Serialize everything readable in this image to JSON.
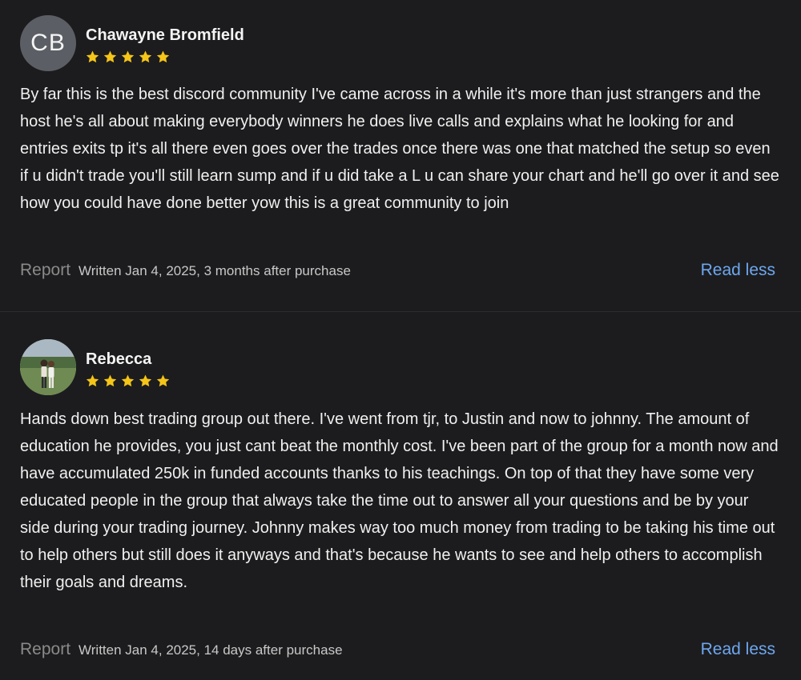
{
  "reviews": [
    {
      "avatar_initials": "CB",
      "name": "Chawayne Bromfield",
      "rating": 5,
      "text": "By far this is the best discord community I've came across in a while it's more than just strangers and the host he's all about making everybody winners he does live calls and explains what he looking for and entries exits tp it's all there even goes over the trades once there was one that matched the setup so even if u didn't trade you'll still learn sump and if u did take a L u can share your chart and he'll go over it and see how you could have done better yow this is a great community to join",
      "report_label": "Report",
      "written": "Written Jan 4, 2025, 3 months after purchase",
      "toggle_label": "Read less"
    },
    {
      "name": "Rebecca",
      "rating": 5,
      "text": "Hands down best trading group out there. I've went from tjr, to Justin and now to johnny. The amount of education he provides, you just cant beat the monthly cost. I've been part of the group for a month now and have accumulated 250k in funded accounts thanks to his teachings. On top of that they have some very educated people in the group that always take the time out to answer all your questions and be by your side during your trading journey. Johnny makes way too much money from trading to be taking his time out to help others but still does it anyways and that's because he wants to see and help others to accomplish their goals and dreams.",
      "report_label": "Report",
      "written": "Written Jan 4, 2025, 14 days after purchase",
      "toggle_label": "Read less"
    }
  ],
  "colors": {
    "background": "#1c1c1e",
    "star": "#f5c518",
    "link": "#6ea7ef",
    "muted": "#8a8a8a"
  }
}
